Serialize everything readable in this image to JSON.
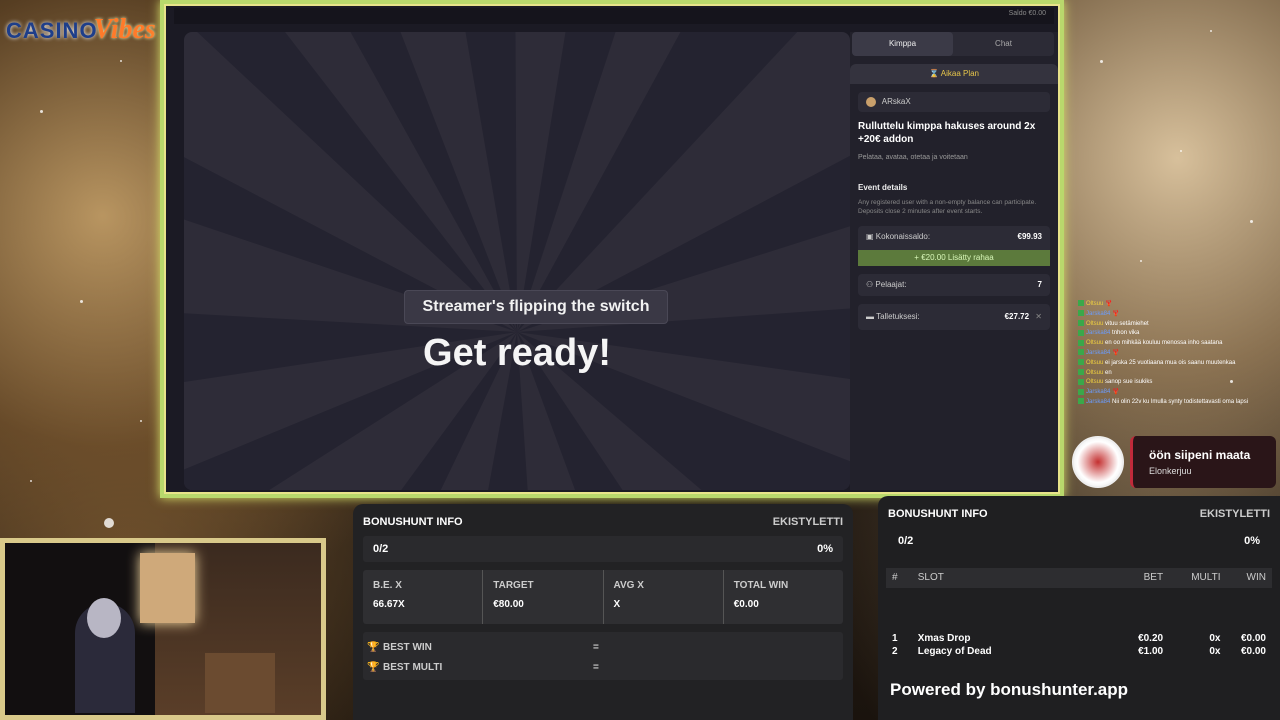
{
  "logo": {
    "part1": "CASINO",
    "part2": "Vibes"
  },
  "game": {
    "topbar_right": "Saldo €0.00",
    "subtitle": "Streamer's flipping the switch",
    "headline": "Get ready!"
  },
  "panel": {
    "tabs": [
      {
        "label": "Kimppa",
        "active": true
      },
      {
        "label": "Chat",
        "active": false
      }
    ],
    "plan_label": "Aikaa Plan",
    "plan_icon": "hourglass-icon",
    "user": "ARskaX",
    "title": "Rulluttelu kimppa hakuses around 2x +20€ addon",
    "subtitle": "Pelataa, avataa, otetaa ja voitetaan",
    "event_heading": "Event details",
    "event_text": "Any registered user with a non-empty balance can participate. Deposits close 2 minutes after event starts.",
    "total_label": "Kokonaissaldo:",
    "total_value": "€99.93",
    "added_label": "€20.00 Lisätty rahaa",
    "players_label": "Pelaajat:",
    "players_value": "7",
    "deposits_label": "Talletuksesi:",
    "deposits_value": "€27.72"
  },
  "chat": [
    {
      "user": "Oltsuu",
      "msg": "🦞"
    },
    {
      "user": "Jarska84",
      "msg": "🦞"
    },
    {
      "user": "Oltsuu",
      "msg": "vituu setämiehet"
    },
    {
      "user": "Jarska84",
      "msg": "tnhon vika"
    },
    {
      "user": "Oltsuu",
      "msg": "en oo mihkää kouluu menossa inho saatana"
    },
    {
      "user": "Jarska84",
      "msg": "🦞"
    },
    {
      "user": "Oltsuu",
      "msg": "ei jarska 25 vuotiaana mua ois saanu muutenkaa"
    },
    {
      "user": "Oltsuu",
      "msg": "en"
    },
    {
      "user": "Oltsuu",
      "msg": "sanop sue isukiks"
    },
    {
      "user": "Jarska84",
      "msg": "🦞"
    },
    {
      "user": "Jarska84",
      "msg": "Nii olin 22v ku lmulla synty todistettavasti oma lapsi"
    }
  ],
  "sub": {
    "title": "öön siipeni maata",
    "name": "Elonkerjuu"
  },
  "bonushunt1": {
    "title": "BONUSHUNT INFO",
    "name": "EKISTYLETTI",
    "progress": "0/2",
    "percent": "0%",
    "stats": [
      {
        "label": "B.E. X",
        "value": "66.67X"
      },
      {
        "label": "TARGET",
        "value": "€80.00"
      },
      {
        "label": "AVG X",
        "value": "X"
      },
      {
        "label": "TOTAL WIN",
        "value": "€0.00"
      }
    ],
    "best_win_label": "BEST WIN",
    "best_multi_label": "BEST MULTI",
    "best_win_value": "=",
    "best_multi_value": "="
  },
  "bonushunt2": {
    "title": "BONUSHUNT INFO",
    "name": "EKISTYLETTI",
    "progress": "0/2",
    "percent": "0%",
    "columns": {
      "no": "#",
      "slot": "SLOT",
      "bet": "BET",
      "multi": "MULTI",
      "win": "WIN"
    },
    "rows": [
      {
        "no": "1",
        "slot": "Xmas Drop",
        "bet": "€0.20",
        "multi": "0x",
        "win": "€0.00"
      },
      {
        "no": "2",
        "slot": "Legacy of Dead",
        "bet": "€1.00",
        "multi": "0x",
        "win": "€0.00"
      }
    ],
    "powered": "Powered by bonushunter.app"
  }
}
